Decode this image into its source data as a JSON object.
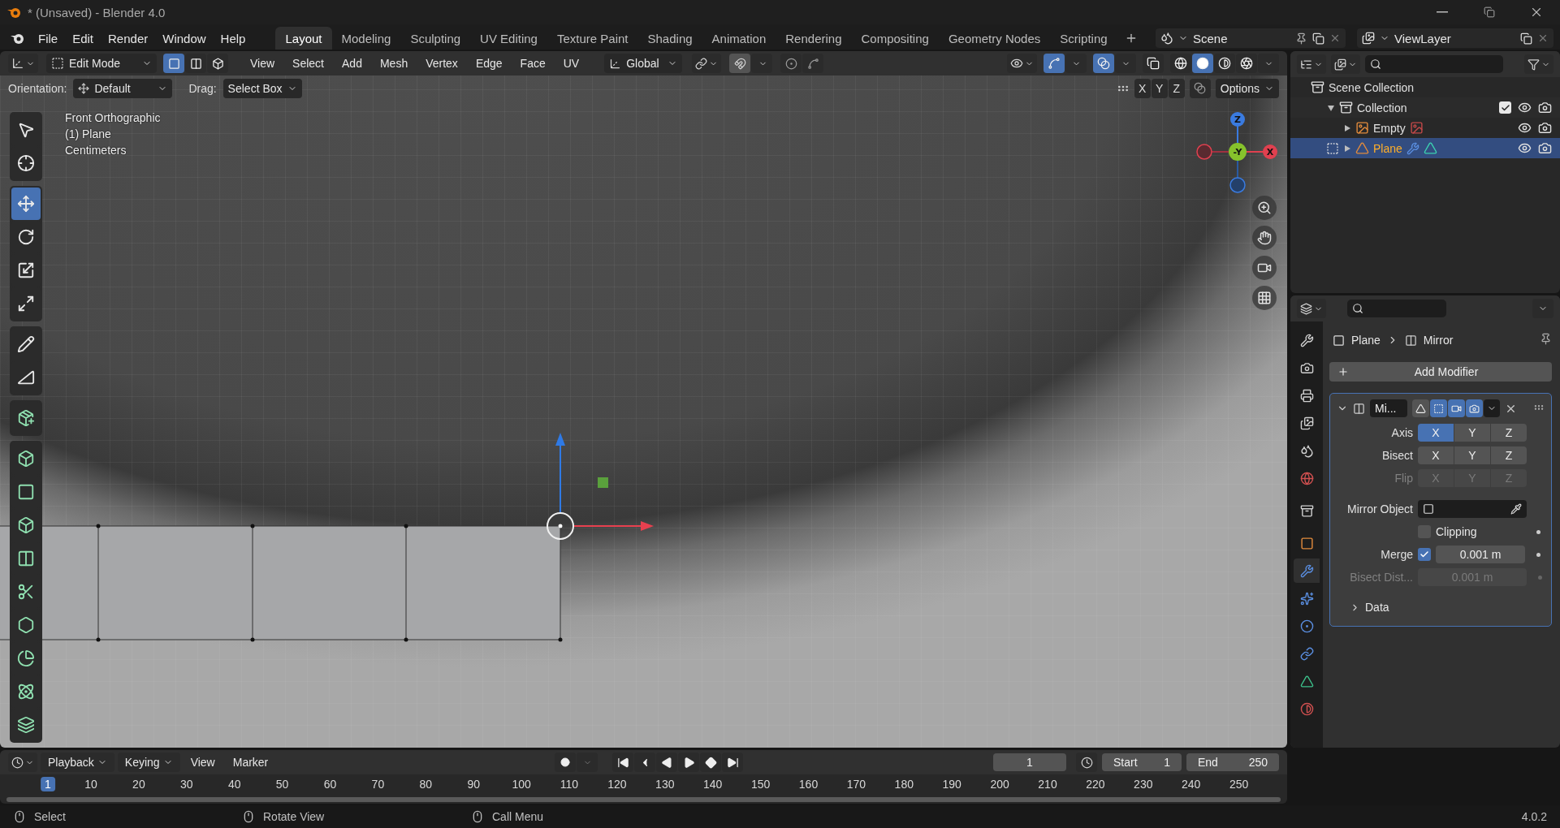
{
  "window": {
    "title": "* (Unsaved) - Blender 4.0"
  },
  "menu": [
    "File",
    "Edit",
    "Render",
    "Window",
    "Help"
  ],
  "workspaces": [
    {
      "label": "Layout",
      "selected": true
    },
    {
      "label": "Modeling",
      "selected": false
    },
    {
      "label": "Sculpting",
      "selected": false
    },
    {
      "label": "UV Editing",
      "selected": false
    },
    {
      "label": "Texture Paint",
      "selected": false
    },
    {
      "label": "Shading",
      "selected": false
    },
    {
      "label": "Animation",
      "selected": false
    },
    {
      "label": "Rendering",
      "selected": false
    },
    {
      "label": "Compositing",
      "selected": false
    },
    {
      "label": "Geometry Nodes",
      "selected": false
    },
    {
      "label": "Scripting",
      "selected": false
    }
  ],
  "scene": {
    "name": "Scene"
  },
  "view_layer": {
    "name": "ViewLayer"
  },
  "viewport_header": {
    "mode": "Edit Mode",
    "select_modes": [
      {
        "selected": true
      },
      {
        "selected": false
      },
      {
        "selected": false
      }
    ],
    "menus": [
      "View",
      "Select",
      "Add",
      "Mesh",
      "Vertex",
      "Edge",
      "Face",
      "UV"
    ],
    "orientation": "Global",
    "toggles": [
      {
        "kind": "gizmo",
        "on": true
      },
      {
        "kind": "overlay",
        "on": true
      },
      {
        "kind": "xray",
        "on": false
      }
    ],
    "shading": [
      {
        "selected": false
      },
      {
        "selected": true
      },
      {
        "selected": false
      },
      {
        "selected": false
      }
    ]
  },
  "tool_settings": {
    "orientation_label": "Orientation:",
    "orientation": "Default",
    "drag_label": "Drag:",
    "drag": "Select Box",
    "mirror_axes": [
      {
        "label": "X",
        "selected": false
      },
      {
        "label": "Y",
        "selected": false
      },
      {
        "label": "Z",
        "selected": false
      }
    ],
    "options": "Options"
  },
  "viewport": {
    "info": [
      "Front Orthographic",
      "(1) Plane",
      "Centimeters"
    ],
    "gizmo_labels": [
      "Z",
      "-Y",
      "X"
    ]
  },
  "tool_groups": [
    {
      "tools": [
        {
          "selected": false
        },
        {
          "selected": false
        }
      ]
    },
    {
      "tools": [
        {
          "selected": true
        },
        {
          "selected": false
        },
        {
          "selected": false
        },
        {
          "selected": false
        }
      ]
    },
    {
      "tools": [
        {
          "selected": false
        },
        {
          "selected": false
        }
      ]
    },
    {
      "tools": [
        {
          "selected": false
        }
      ]
    },
    {
      "tools": [
        {
          "selected": false
        },
        {
          "selected": false
        },
        {
          "selected": false
        },
        {
          "selected": false
        },
        {
          "selected": false
        },
        {
          "selected": false
        },
        {
          "selected": false
        },
        {
          "selected": false
        },
        {
          "selected": false
        }
      ]
    }
  ],
  "outliner": {
    "items": [
      {
        "label": "Scene Collection",
        "kind": "scene_collection",
        "children": [
          {
            "label": "Collection",
            "kind": "collection",
            "expanded": true,
            "checked": true,
            "children": [
              {
                "label": "Empty",
                "kind": "empty",
                "expanded": false,
                "selected": false
              },
              {
                "label": "Plane",
                "kind": "mesh",
                "expanded": false,
                "selected": true
              }
            ]
          }
        ]
      }
    ]
  },
  "properties": {
    "tabs": [
      {
        "selected": false
      },
      {
        "selected": false
      },
      {
        "selected": false
      },
      {
        "selected": false
      },
      {
        "selected": false
      },
      {
        "selected": false
      },
      {
        "selected": false
      },
      {
        "selected": false
      },
      {
        "selected": true
      },
      {
        "selected": false
      },
      {
        "selected": false
      },
      {
        "selected": false
      },
      {
        "selected": false
      },
      {
        "selected": false
      }
    ],
    "breadcrumb": {
      "object": "Plane",
      "modifier": "Mirror"
    },
    "add_modifier": "Add Modifier",
    "modifier": {
      "name": "Mi...",
      "expanded": true,
      "toggles": [
        {
          "on": false
        },
        {
          "on": true
        },
        {
          "on": true
        },
        {
          "on": true
        }
      ],
      "axis_rows": [
        {
          "label": "Axis",
          "disabled": false,
          "buttons": [
            {
              "label": "X",
              "selected": true
            },
            {
              "label": "Y",
              "selected": false
            },
            {
              "label": "Z",
              "selected": false
            }
          ]
        },
        {
          "label": "Bisect",
          "disabled": false,
          "buttons": [
            {
              "label": "X",
              "selected": false
            },
            {
              "label": "Y",
              "selected": false
            },
            {
              "label": "Z",
              "selected": false
            }
          ]
        },
        {
          "label": "Flip",
          "disabled": true,
          "buttons": [
            {
              "label": "X",
              "selected": false
            },
            {
              "label": "Y",
              "selected": false
            },
            {
              "label": "Z",
              "selected": false
            }
          ]
        }
      ],
      "mirror_object": {
        "label": "Mirror Object"
      },
      "clipping": {
        "label": "Clipping",
        "checked": false
      },
      "merge": {
        "label": "Merge",
        "checked": true,
        "value": "0.001 m"
      },
      "bisect_distance": {
        "label": "Bisect Dist...",
        "value": "0.001 m",
        "disabled": true
      },
      "data": {
        "label": "Data",
        "expanded": false
      }
    }
  },
  "timeline": {
    "menus": [
      {
        "label": "Playback",
        "dropdown": true
      },
      {
        "label": "Keying",
        "dropdown": true
      },
      {
        "label": "View",
        "dropdown": false
      },
      {
        "label": "Marker",
        "dropdown": false
      }
    ],
    "current_frame": "1",
    "start": {
      "label": "Start",
      "value": "1"
    },
    "end": {
      "label": "End",
      "value": "250"
    },
    "ruler": [
      {
        "label": "1",
        "selected": true
      },
      {
        "label": "10",
        "selected": false
      },
      {
        "label": "20",
        "selected": false
      },
      {
        "label": "30",
        "selected": false
      },
      {
        "label": "40",
        "selected": false
      },
      {
        "label": "50",
        "selected": false
      },
      {
        "label": "60",
        "selected": false
      },
      {
        "label": "70",
        "selected": false
      },
      {
        "label": "80",
        "selected": false
      },
      {
        "label": "90",
        "selected": false
      },
      {
        "label": "100",
        "selected": false
      },
      {
        "label": "110",
        "selected": false
      },
      {
        "label": "120",
        "selected": false
      },
      {
        "label": "130",
        "selected": false
      },
      {
        "label": "140",
        "selected": false
      },
      {
        "label": "150",
        "selected": false
      },
      {
        "label": "160",
        "selected": false
      },
      {
        "label": "170",
        "selected": false
      },
      {
        "label": "180",
        "selected": false
      },
      {
        "label": "190",
        "selected": false
      },
      {
        "label": "200",
        "selected": false
      },
      {
        "label": "210",
        "selected": false
      },
      {
        "label": "220",
        "selected": false
      },
      {
        "label": "230",
        "selected": false
      },
      {
        "label": "240",
        "selected": false
      },
      {
        "label": "250",
        "selected": false
      }
    ]
  },
  "status_bar": {
    "hints": [
      "Select",
      "Rotate View",
      "Call Menu"
    ],
    "version": "4.0.2"
  }
}
